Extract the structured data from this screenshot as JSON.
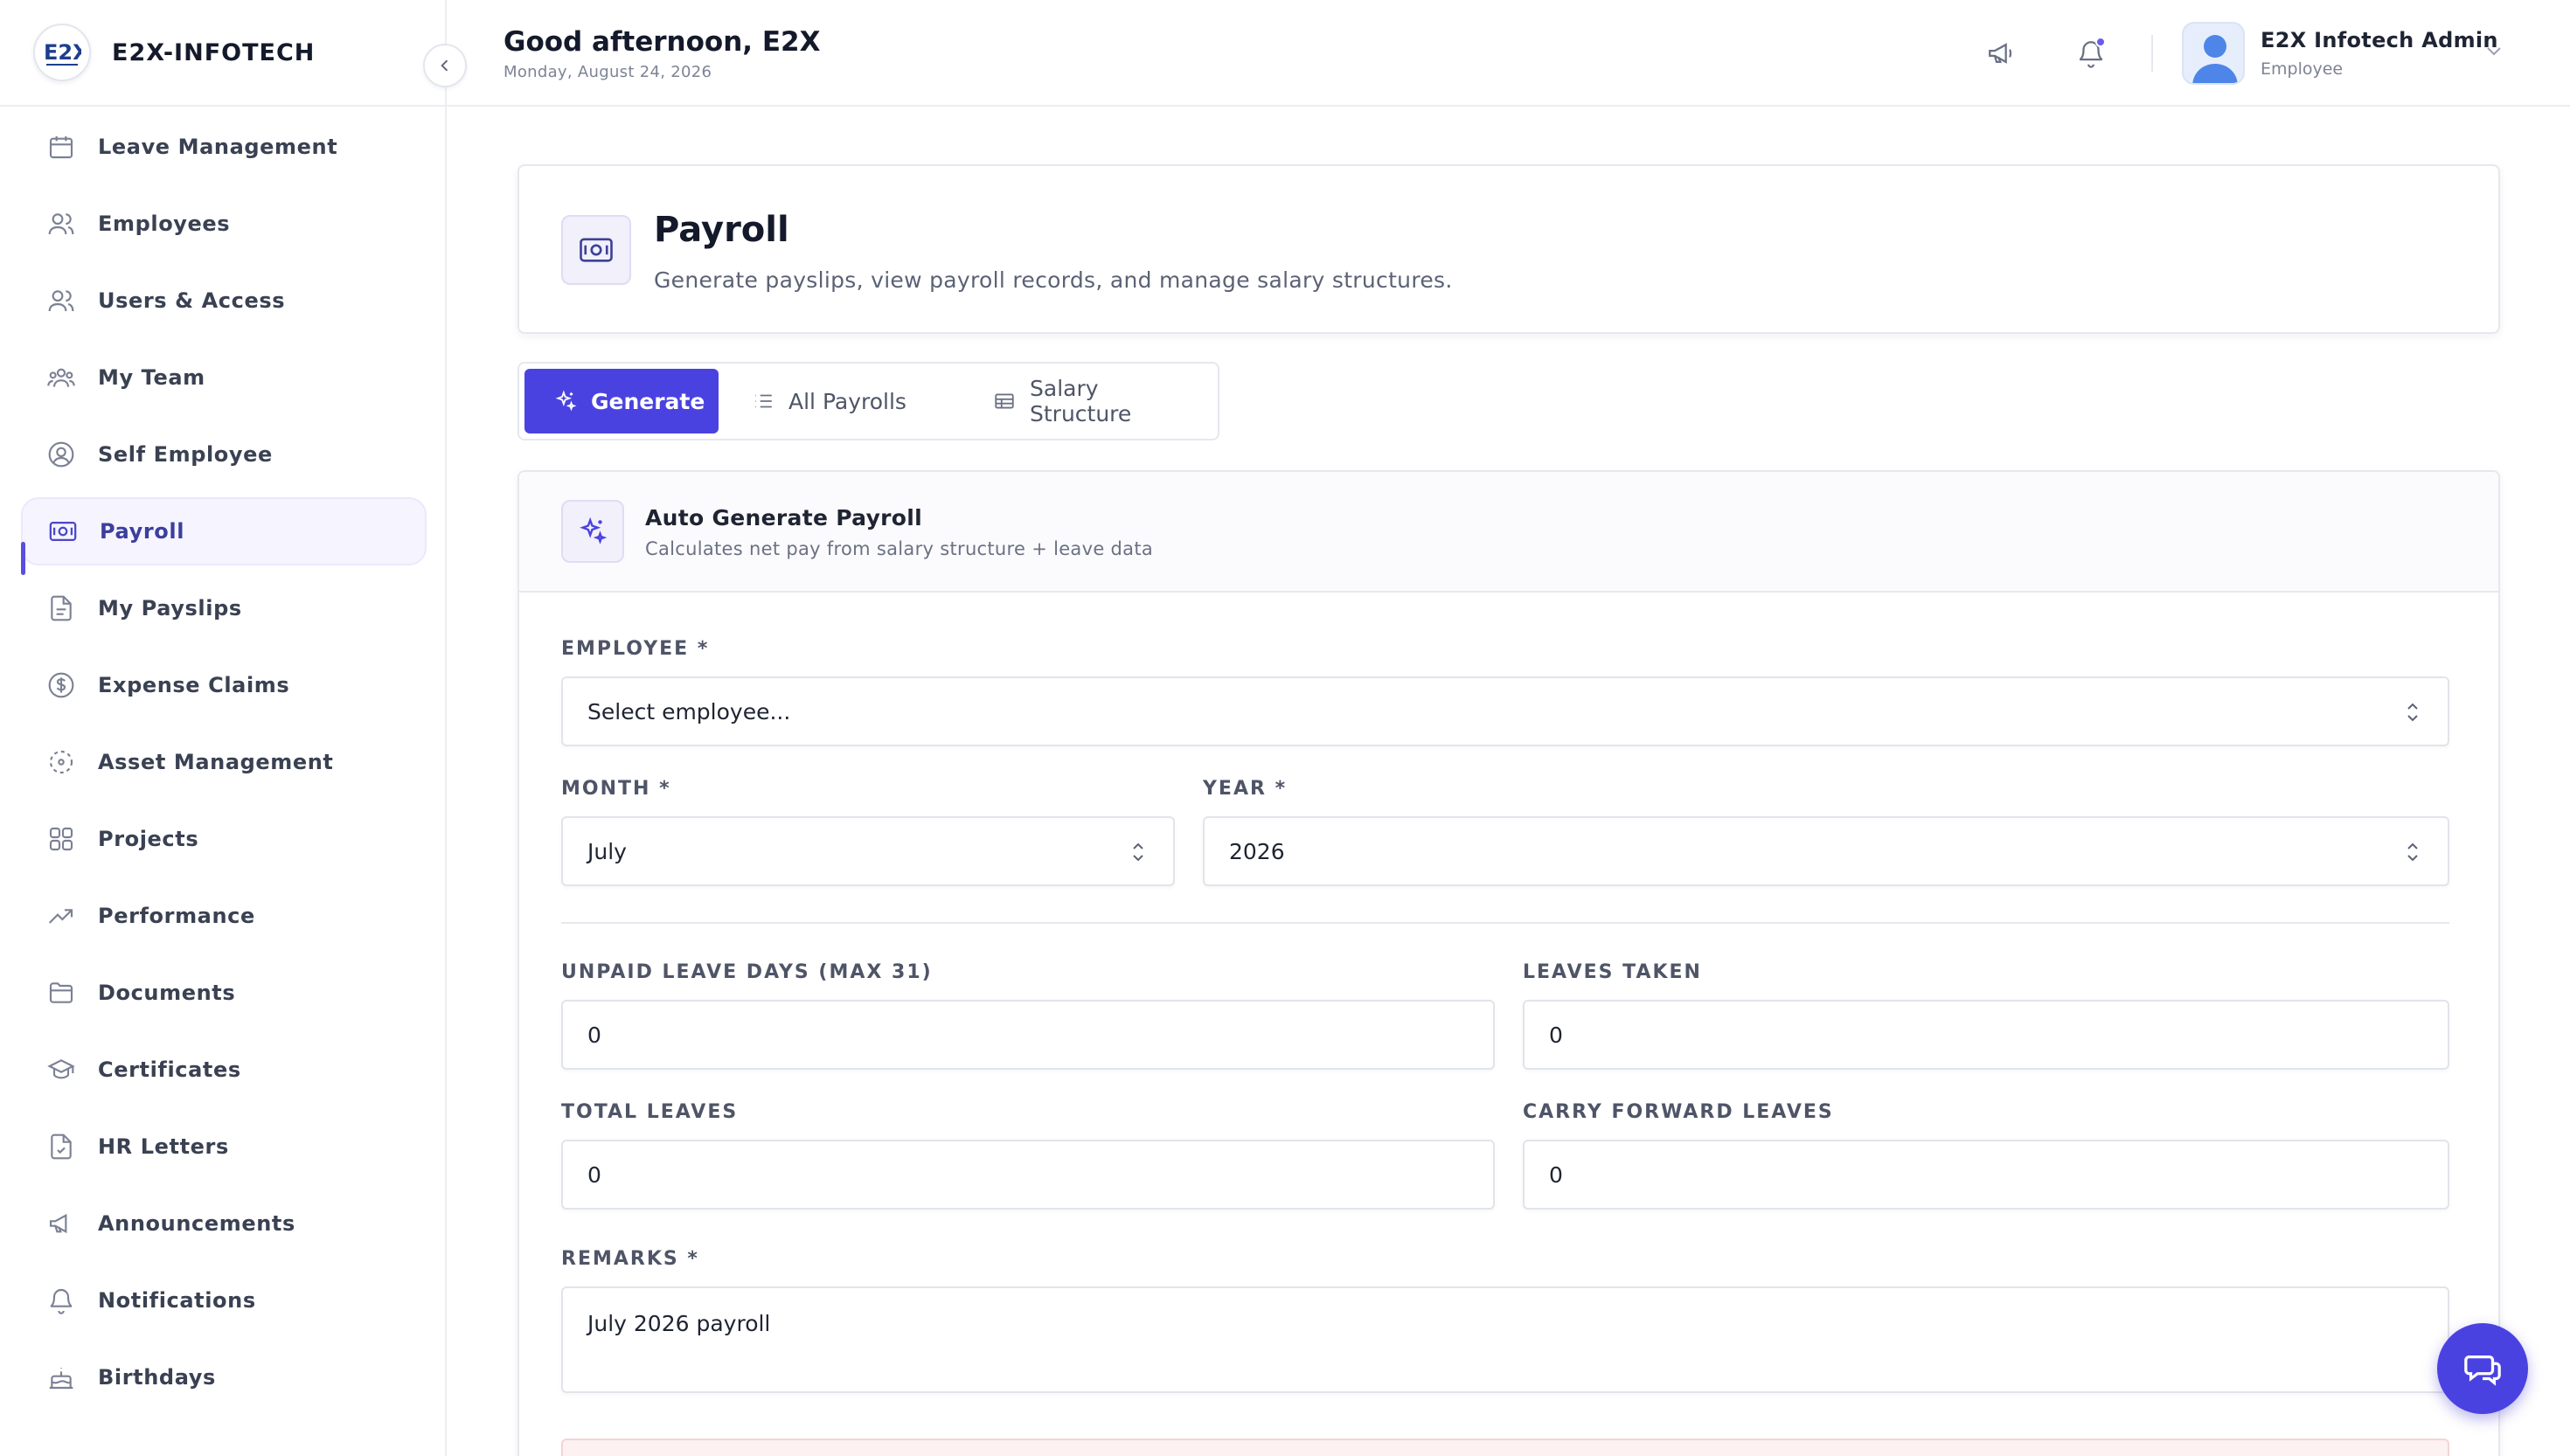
{
  "brand": {
    "name": "E2X-INFOTECH",
    "logo_text": "E2X"
  },
  "sidebar": {
    "items": [
      {
        "label": "Leave Management",
        "icon": "calendar-icon"
      },
      {
        "label": "Employees",
        "icon": "users-icon"
      },
      {
        "label": "Users & Access",
        "icon": "users-access-icon"
      },
      {
        "label": "My Team",
        "icon": "team-icon"
      },
      {
        "label": "Self Employee",
        "icon": "user-circle-icon"
      },
      {
        "label": "Payroll",
        "icon": "payroll-icon",
        "active": true
      },
      {
        "label": "My Payslips",
        "icon": "file-icon"
      },
      {
        "label": "Expense Claims",
        "icon": "dollar-icon"
      },
      {
        "label": "Asset Management",
        "icon": "asset-icon"
      },
      {
        "label": "Projects",
        "icon": "grid-icon"
      },
      {
        "label": "Performance",
        "icon": "trending-up-icon"
      },
      {
        "label": "Documents",
        "icon": "folder-icon"
      },
      {
        "label": "Certificates",
        "icon": "graduation-cap-icon"
      },
      {
        "label": "HR Letters",
        "icon": "file-check-icon"
      },
      {
        "label": "Announcements",
        "icon": "megaphone-icon"
      },
      {
        "label": "Notifications",
        "icon": "bell-icon"
      },
      {
        "label": "Birthdays",
        "icon": "cake-icon"
      }
    ]
  },
  "header": {
    "greeting": "Good afternoon, E2X",
    "date": "Monday, August 24, 2026",
    "user": {
      "name": "E2X Infotech Admin",
      "role": "Employee"
    }
  },
  "page": {
    "title": "Payroll",
    "subtitle": "Generate payslips, view payroll records, and manage salary structures."
  },
  "tabs": [
    {
      "label": "Generate",
      "icon": "sparkles-icon",
      "active": true
    },
    {
      "label": "All Payrolls",
      "icon": "list-icon"
    },
    {
      "label": "Salary Structure",
      "icon": "table-icon"
    }
  ],
  "form": {
    "title": "Auto Generate Payroll",
    "subtitle": "Calculates net pay from salary structure + leave data",
    "employee": {
      "label": "EMPLOYEE *",
      "value": "Select employee..."
    },
    "month": {
      "label": "MONTH *",
      "value": "July"
    },
    "year": {
      "label": "YEAR *",
      "value": "2026"
    },
    "unpaid_leave": {
      "label": "UNPAID LEAVE DAYS (MAX 31)",
      "value": "0"
    },
    "leaves_taken": {
      "label": "LEAVES TAKEN",
      "value": "0"
    },
    "total_leaves": {
      "label": "TOTAL LEAVES",
      "value": "0"
    },
    "carry_forward": {
      "label": "CARRY FORWARD LEAVES",
      "value": "0"
    },
    "remarks": {
      "label": "REMARKS *",
      "value": "July 2026 payroll"
    }
  },
  "colors": {
    "accent": "#4a42e0",
    "active_bg": "#f6f4ff",
    "border": "#e6e8ee"
  }
}
